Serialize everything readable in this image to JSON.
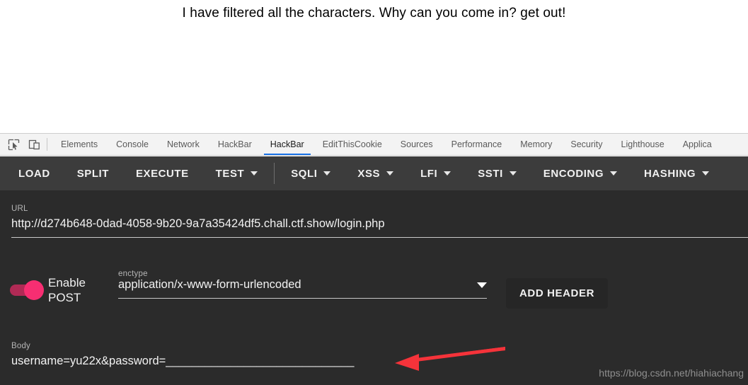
{
  "page": {
    "message": "I have filtered all the characters. Why can you come in? get out!"
  },
  "devtools": {
    "icons": [
      {
        "name": "inspect-element-icon"
      },
      {
        "name": "device-toolbar-icon"
      }
    ],
    "tabs": [
      {
        "label": "Elements",
        "active": false
      },
      {
        "label": "Console",
        "active": false
      },
      {
        "label": "Network",
        "active": false
      },
      {
        "label": "HackBar",
        "active": false
      },
      {
        "label": "HackBar",
        "active": true
      },
      {
        "label": "EditThisCookie",
        "active": false
      },
      {
        "label": "Sources",
        "active": false
      },
      {
        "label": "Performance",
        "active": false
      },
      {
        "label": "Memory",
        "active": false
      },
      {
        "label": "Security",
        "active": false
      },
      {
        "label": "Lighthouse",
        "active": false
      },
      {
        "label": "Applica",
        "active": false
      }
    ]
  },
  "hackbar": {
    "toolbar": [
      {
        "label": "LOAD",
        "caret": false
      },
      {
        "label": "SPLIT",
        "caret": false
      },
      {
        "label": "EXECUTE",
        "caret": false
      },
      {
        "label": "TEST",
        "caret": true
      },
      {
        "divider": true
      },
      {
        "label": "SQLI",
        "caret": true
      },
      {
        "label": "XSS",
        "caret": true
      },
      {
        "label": "LFI",
        "caret": true
      },
      {
        "label": "SSTI",
        "caret": true
      },
      {
        "label": "ENCODING",
        "caret": true
      },
      {
        "label": "HASHING",
        "caret": true
      }
    ],
    "url": {
      "label": "URL",
      "value": "http://d274b648-0dad-4058-9b20-9a7a35424df5.chall.ctf.show/login.php"
    },
    "post": {
      "toggle_label": "Enable POST",
      "toggle_on": true,
      "toggle_track_color": "#b02a55",
      "toggle_knob_color": "#f72e72",
      "enctype_label": "enctype",
      "enctype_value": "application/x-www-form-urlencoded",
      "add_header_label": "ADD HEADER"
    },
    "body": {
      "label": "Body",
      "value": "username=yu22x&password=_____________________________"
    }
  },
  "annotation": {
    "arrow_color": "#f5333a"
  },
  "watermark": {
    "text": "https://blog.csdn.net/hiahiachang"
  },
  "colors": {
    "panel_bg": "#2b2b2b",
    "toolbar_bg": "#3c3c3c",
    "tabbar_bg": "#f3f3f3",
    "active_tab_underline": "#1a73e8"
  }
}
